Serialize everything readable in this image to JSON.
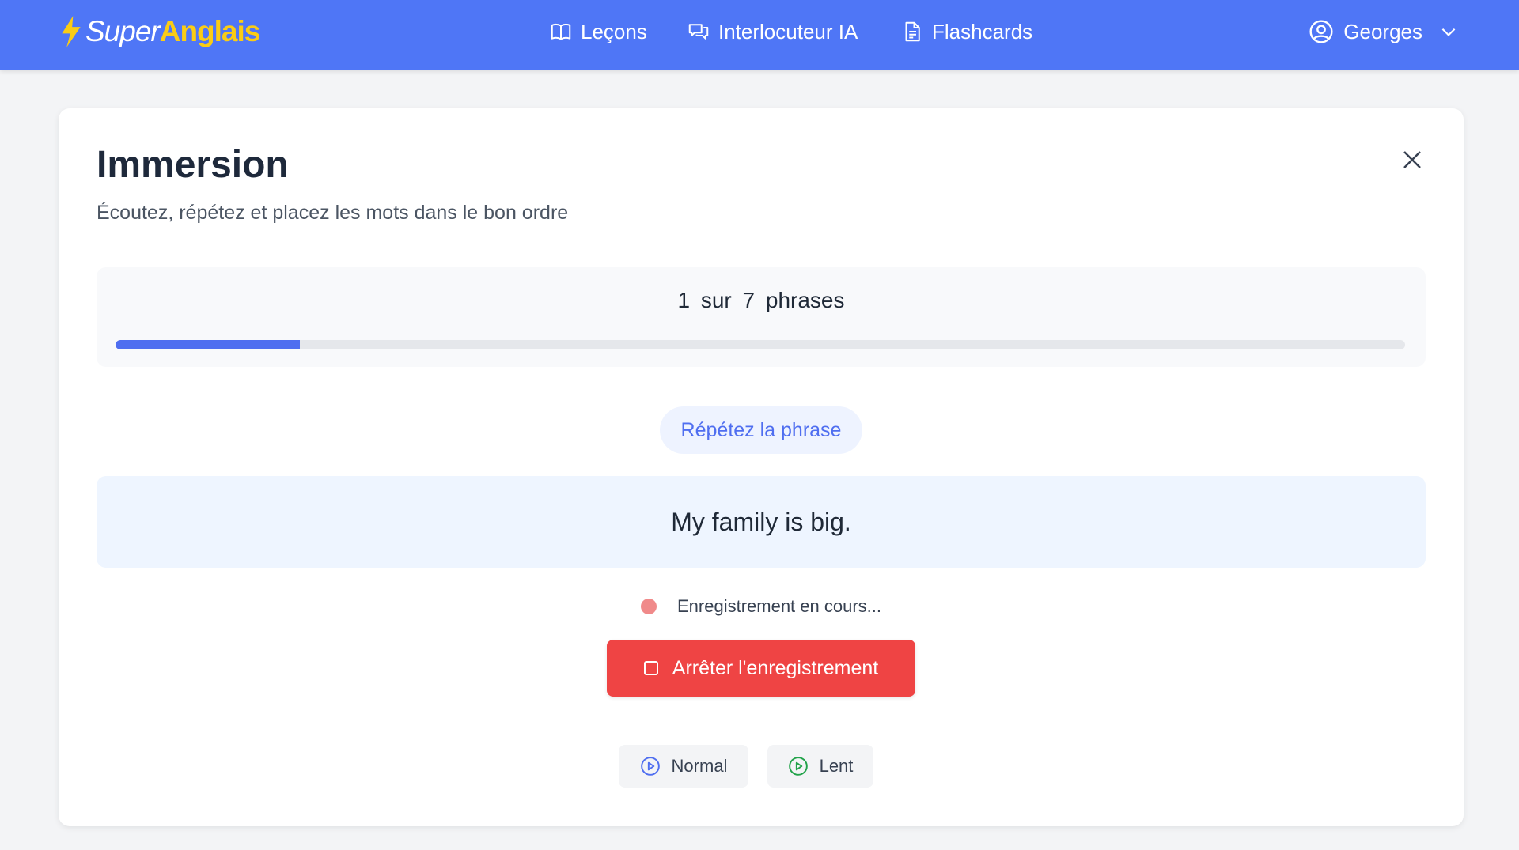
{
  "app": {
    "logo_super": "Super",
    "logo_anglais": "Anglais",
    "nav": [
      {
        "label": "Leçons",
        "icon": "book-icon"
      },
      {
        "label": "Interlocuteur IA",
        "icon": "chat-bubbles-icon"
      },
      {
        "label": "Flashcards",
        "icon": "document-icon"
      }
    ],
    "user": {
      "name": "Georges",
      "icon": "user-circle-icon"
    }
  },
  "card": {
    "title": "Immersion",
    "subtitle": "Écoutez, répétez et placez les mots dans le bon ordre",
    "progress": {
      "current": "1",
      "sep": "sur",
      "total": "7",
      "unit": "phrases",
      "fraction": 0.1428
    },
    "instruction": "Répétez la phrase",
    "sentence": "My family is big.",
    "recording_status": "Enregistrement en cours...",
    "stop_label": "Arrêter l'enregistrement",
    "speed_normal": "Normal",
    "speed_slow": "Lent"
  },
  "colors": {
    "header": "#4f76f6",
    "accent": "#4f6ef0",
    "logo_yellow": "#facc15",
    "stop_red": "#ef4444",
    "slow_green": "#22a34a"
  }
}
